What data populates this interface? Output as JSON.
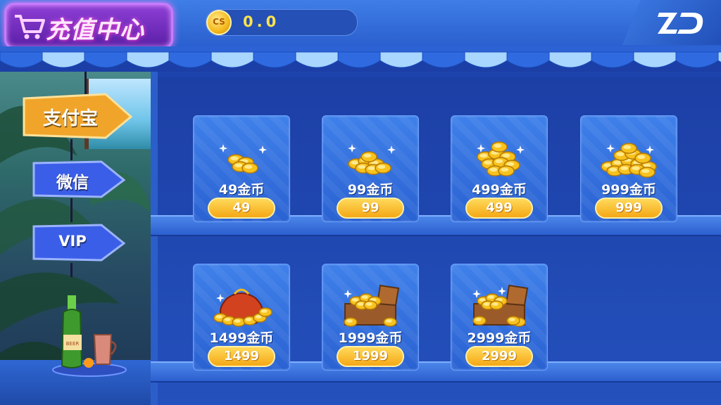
{
  "header": {
    "title": "充值中心",
    "cart_icon": "shopping-cart-icon",
    "balance": {
      "icon": "coin-icon",
      "icon_text": "CS",
      "value": "0.0"
    },
    "logo": "zd-logo-icon"
  },
  "payment_methods": [
    {
      "label": "支付宝",
      "selected": true
    },
    {
      "label": "微信",
      "selected": false
    },
    {
      "label": "VIP",
      "selected": false
    }
  ],
  "decor": {
    "bottle_text": "BEER"
  },
  "products": [
    {
      "amount_label": "49金币",
      "price": "49",
      "art": "small-coin-pile-icon"
    },
    {
      "amount_label": "99金币",
      "price": "99",
      "art": "coin-pile-icon"
    },
    {
      "amount_label": "499金币",
      "price": "499",
      "art": "coin-stack-icon"
    },
    {
      "amount_label": "999金币",
      "price": "999",
      "art": "large-coin-pile-icon"
    },
    {
      "amount_label": "1499金币",
      "price": "1499",
      "art": "coin-bag-icon"
    },
    {
      "amount_label": "1999金币",
      "price": "1999",
      "art": "treasure-chest-icon"
    },
    {
      "amount_label": "2999金币",
      "price": "2999",
      "art": "large-treasure-chest-icon"
    }
  ],
  "colors": {
    "accent_gold": "#f5a816",
    "shelf_blue": "#1d43ad",
    "title_purple": "#8e3fd6"
  }
}
